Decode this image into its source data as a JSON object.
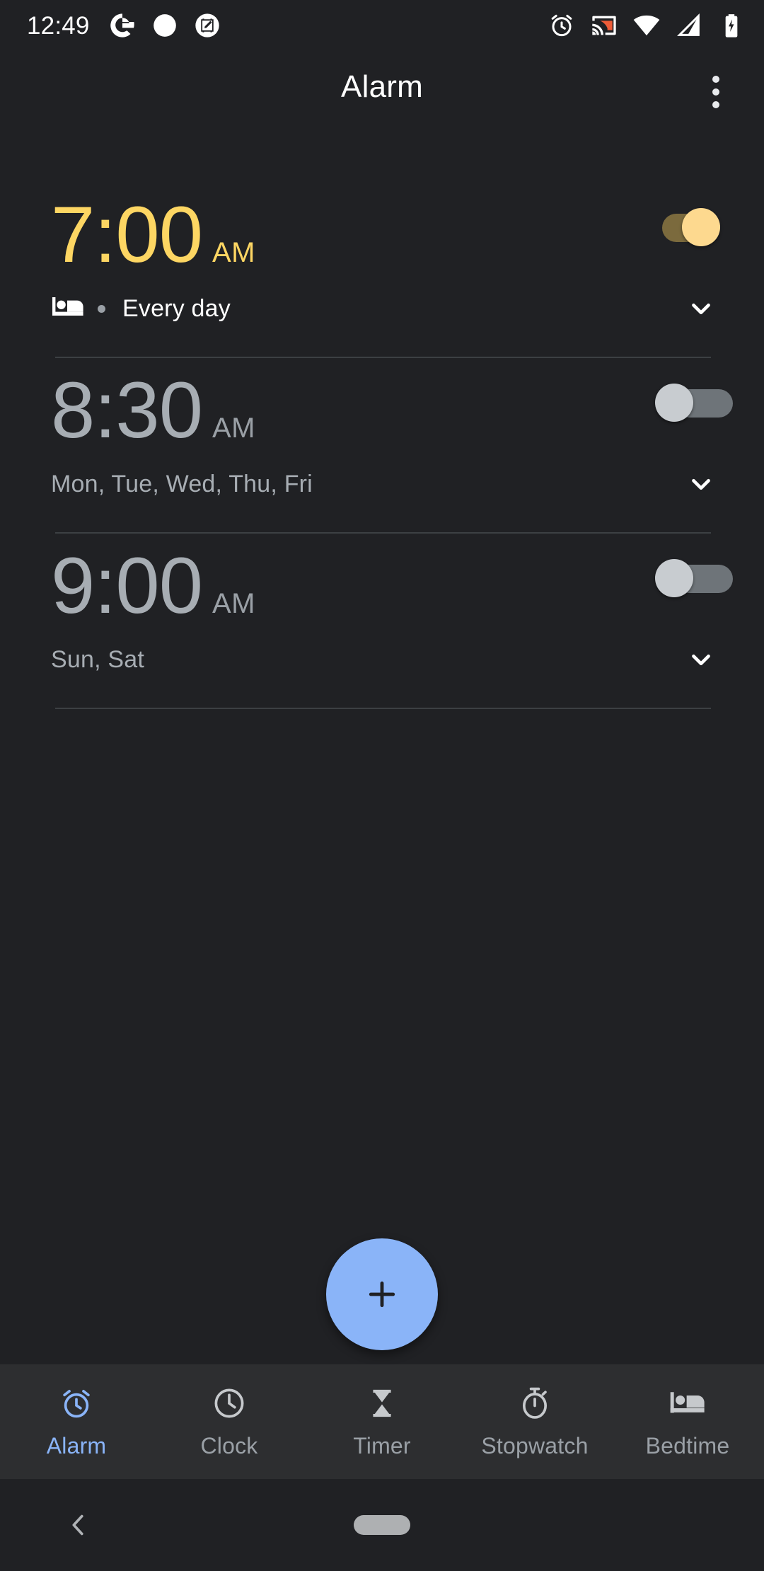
{
  "status_bar": {
    "time": "12:49",
    "left_icons": [
      "google-g-icon",
      "circle-dot-icon",
      "screenshot-edit-icon"
    ],
    "right_icons": [
      "alarm-set-icon",
      "cast-icon",
      "wifi-icon",
      "cellular-signal-icon",
      "battery-charging-icon"
    ]
  },
  "app_bar": {
    "title": "Alarm",
    "overflow_label": "More options"
  },
  "alarms": [
    {
      "time": "7:00",
      "ampm": "AM",
      "enabled": true,
      "schedule": "Every day",
      "has_bed_icon": true,
      "expand_icon": "chevron-down-icon"
    },
    {
      "time": "8:30",
      "ampm": "AM",
      "enabled": false,
      "schedule": "Mon, Tue, Wed, Thu, Fri",
      "has_bed_icon": false,
      "expand_icon": "chevron-down-icon"
    },
    {
      "time": "9:00",
      "ampm": "AM",
      "enabled": false,
      "schedule": "Sun, Sat",
      "has_bed_icon": false,
      "expand_icon": "chevron-down-icon"
    }
  ],
  "fab": {
    "icon": "plus-icon",
    "label": "Add alarm"
  },
  "bottom_nav": {
    "tabs": [
      {
        "label": "Alarm",
        "icon": "alarm-clock-icon",
        "active": true
      },
      {
        "label": "Clock",
        "icon": "clock-icon",
        "active": false
      },
      {
        "label": "Timer",
        "icon": "hourglass-icon",
        "active": false
      },
      {
        "label": "Stopwatch",
        "icon": "stopwatch-icon",
        "active": false
      },
      {
        "label": "Bedtime",
        "icon": "bed-icon",
        "active": false
      }
    ]
  },
  "system_nav": {
    "back_icon": "back-chevron-icon",
    "home_icon": "home-pill-icon"
  },
  "colors": {
    "background": "#202124",
    "accent_amber": "#fdd663",
    "accent_blue": "#8ab4f8",
    "text_primary": "#ffffff",
    "text_secondary": "#9aa0a6",
    "nav_bar_bg": "#2d2e30"
  }
}
